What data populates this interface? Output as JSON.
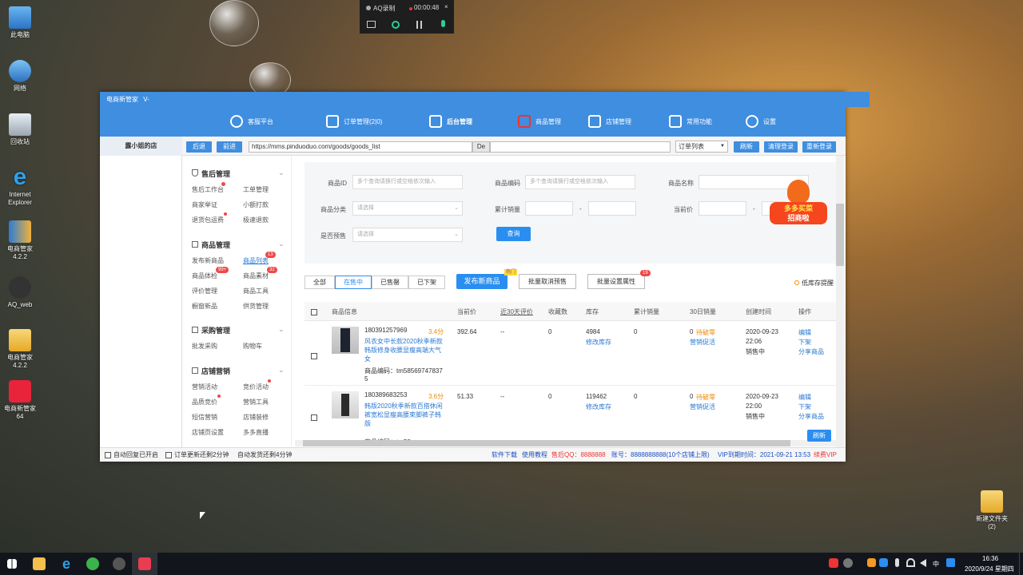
{
  "desktop": {
    "icons": [
      {
        "label": "此电脑"
      },
      {
        "label": "网络"
      },
      {
        "label": "回收站"
      },
      {
        "label": "Internet Explorer"
      },
      {
        "label": "电商管家 4.2.2"
      },
      {
        "label": "AQ_web"
      },
      {
        "label": "电商管家 4.2.2"
      },
      {
        "label": "电商新管家 64"
      }
    ],
    "right_icon": "新建文件夹 (2)"
  },
  "recorder": {
    "title": "AQ录制",
    "time": "00:00:48"
  },
  "app": {
    "title": "电商新管家",
    "version": "V-",
    "nav": [
      "客服平台",
      "订单管理(2|0)",
      "后台管理",
      "商品管理",
      "店铺管理",
      "常用功能",
      "设置"
    ],
    "shop": "露小姐的店",
    "toolbar": {
      "back": "后退",
      "forward": "前进",
      "url": "https://mms.pinduoduo.com/goods/goods_list",
      "de": "De",
      "select": "订单列表",
      "refresh": "刷新",
      "clear_login": "清理登录",
      "relogin": "重新登录"
    },
    "sidebar": {
      "s1": "售后管理",
      "s1_items": [
        "售后工作台",
        "工单管理",
        "商家举证",
        "小额打款",
        "退货包运费",
        "极速退款"
      ],
      "s2": "商品管理",
      "s2_items": [
        "发布新商品",
        "商品列表",
        "商品体检",
        "商品素材",
        "评价管理",
        "商品工具",
        "橱窗新品",
        "供货管理"
      ],
      "s2_badges": [
        "13",
        "99+",
        "32"
      ],
      "s3": "采购管理",
      "s3_items": [
        "批发采购",
        "购物车"
      ],
      "s4": "店铺营销",
      "s4_items": [
        "营销活动",
        "竞价活动",
        "品质竞价",
        "营销工具",
        "短信营销",
        "店铺装修",
        "店铺页设置",
        "多多直播"
      ]
    },
    "filter": {
      "id_label": "商品ID",
      "id_ph": "多个查询请换行或空格依次输入",
      "code_label": "商品编码",
      "code_ph": "多个查询请换行或空格依次输入",
      "name_label": "商品名称",
      "cat_label": "商品分类",
      "cat_ph": "请选择",
      "sales_label": "累计销量",
      "price_label": "当前价",
      "presale_label": "是否预售",
      "presale_ph": "请选择",
      "query": "查询",
      "dash": "-"
    },
    "promo": {
      "line1": "多多买菜",
      "line2": "招商啦"
    },
    "tabs": {
      "all": "全部",
      "selling": "在售中",
      "soldout": "已售罄",
      "offline": "已下架",
      "publish": "发布新商品",
      "hot": "热门",
      "cancel_presale": "批量取消预售",
      "batch_attr": "批量设置属性",
      "batch_badge": "19",
      "low_stock": "低库存提醒"
    },
    "table": {
      "headers": [
        "商品信息",
        "当前价",
        "近30天评价",
        "收藏数",
        "库存",
        "累计销量",
        "30日销量",
        "创建时间",
        "操作"
      ],
      "rows": [
        {
          "id": "180391257969",
          "score": "3.4分",
          "title": "风衣女中长款2020秋季新款韩版修身收腰显瘦高端大气女",
          "code": "商品编码：tm585697478375",
          "price": "392.64",
          "review": "--",
          "fav": "0",
          "stock": "4984",
          "stock_edit": "修改库存",
          "total": "0",
          "sales30": "0",
          "sales30_link": "待破零",
          "promo": "营销促活",
          "date": "2020-09-23",
          "time": "22:06",
          "status": "销售中",
          "op1": "编辑",
          "op2": "下架",
          "op3": "分享商品"
        },
        {
          "id": "180389683253",
          "score": "3.6分",
          "title": "韩版2020秋季新款百搭休闲裤宽松显瘦高腰束脚裤子韩版",
          "code": "商品编码：tm58",
          "price": "51.33",
          "review": "--",
          "fav": "0",
          "stock": "119462",
          "stock_edit": "修改库存",
          "total": "0",
          "sales30": "0",
          "sales30_link": "待破零",
          "promo": "营销促活",
          "date": "2020-09-23",
          "time": "22:00",
          "status": "销售中",
          "op1": "编辑",
          "op2": "下架",
          "op3": "分享商品"
        }
      ]
    },
    "refresh_btn": "刷新",
    "status": {
      "auto_reply": "自动回复已开启",
      "order_update": "订单更新还剩2分钟",
      "auto_ship": "自动发货还剩4分钟",
      "download": "软件下载",
      "tutorial": "使用教程",
      "qq": "售后QQ：8888888",
      "account": "账号：8888888888(10个店铺上限)",
      "vip": "VIP到期时间：2021-09-21 13:53",
      "renew": "续费VIP"
    }
  },
  "taskbar": {
    "time": "16:36",
    "date": "2020/9/24 星期四",
    "ime": "中"
  }
}
